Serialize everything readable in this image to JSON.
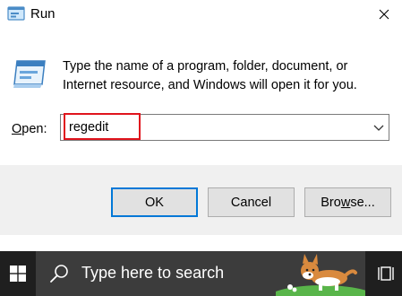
{
  "window": {
    "title": "Run",
    "icons": {
      "app": "run-app-icon",
      "close": "close-icon",
      "graphic": "run-program-icon"
    }
  },
  "content": {
    "description": "Type the name of a program, folder, document, or Internet resource, and Windows will open it for you.",
    "open_label_hotkey": "O",
    "open_label_rest": "pen:",
    "input_value": "regedit",
    "dropdown_icon": "chevron-down-icon",
    "highlight_color": "#e0141d"
  },
  "buttons": {
    "ok": "OK",
    "cancel": "Cancel",
    "browse_prefix": "Bro",
    "browse_hotkey": "w",
    "browse_suffix": "se...",
    "accent_color": "#0078d7"
  },
  "taskbar": {
    "search_placeholder": "Type here to search",
    "start_icon": "windows-logo-icon",
    "search_icon": "search-icon",
    "task_view_icon": "task-view-icon",
    "background": "#1f1f1f"
  }
}
